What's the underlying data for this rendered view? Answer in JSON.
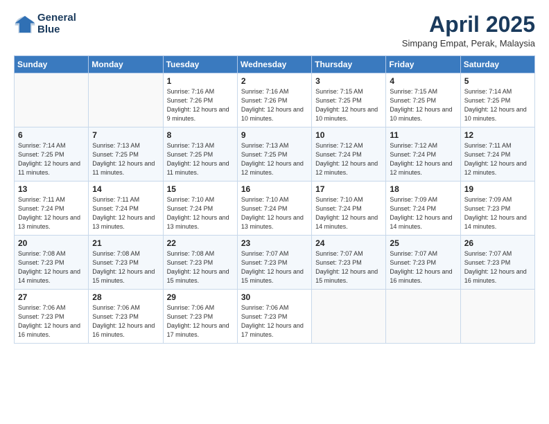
{
  "header": {
    "logo_line1": "General",
    "logo_line2": "Blue",
    "title": "April 2025",
    "subtitle": "Simpang Empat, Perak, Malaysia"
  },
  "days_of_week": [
    "Sunday",
    "Monday",
    "Tuesday",
    "Wednesday",
    "Thursday",
    "Friday",
    "Saturday"
  ],
  "weeks": [
    [
      {
        "day": "",
        "sunrise": "",
        "sunset": "",
        "daylight": ""
      },
      {
        "day": "",
        "sunrise": "",
        "sunset": "",
        "daylight": ""
      },
      {
        "day": "1",
        "sunrise": "Sunrise: 7:16 AM",
        "sunset": "Sunset: 7:26 PM",
        "daylight": "Daylight: 12 hours and 9 minutes."
      },
      {
        "day": "2",
        "sunrise": "Sunrise: 7:16 AM",
        "sunset": "Sunset: 7:26 PM",
        "daylight": "Daylight: 12 hours and 10 minutes."
      },
      {
        "day": "3",
        "sunrise": "Sunrise: 7:15 AM",
        "sunset": "Sunset: 7:25 PM",
        "daylight": "Daylight: 12 hours and 10 minutes."
      },
      {
        "day": "4",
        "sunrise": "Sunrise: 7:15 AM",
        "sunset": "Sunset: 7:25 PM",
        "daylight": "Daylight: 12 hours and 10 minutes."
      },
      {
        "day": "5",
        "sunrise": "Sunrise: 7:14 AM",
        "sunset": "Sunset: 7:25 PM",
        "daylight": "Daylight: 12 hours and 10 minutes."
      }
    ],
    [
      {
        "day": "6",
        "sunrise": "Sunrise: 7:14 AM",
        "sunset": "Sunset: 7:25 PM",
        "daylight": "Daylight: 12 hours and 11 minutes."
      },
      {
        "day": "7",
        "sunrise": "Sunrise: 7:13 AM",
        "sunset": "Sunset: 7:25 PM",
        "daylight": "Daylight: 12 hours and 11 minutes."
      },
      {
        "day": "8",
        "sunrise": "Sunrise: 7:13 AM",
        "sunset": "Sunset: 7:25 PM",
        "daylight": "Daylight: 12 hours and 11 minutes."
      },
      {
        "day": "9",
        "sunrise": "Sunrise: 7:13 AM",
        "sunset": "Sunset: 7:25 PM",
        "daylight": "Daylight: 12 hours and 12 minutes."
      },
      {
        "day": "10",
        "sunrise": "Sunrise: 7:12 AM",
        "sunset": "Sunset: 7:24 PM",
        "daylight": "Daylight: 12 hours and 12 minutes."
      },
      {
        "day": "11",
        "sunrise": "Sunrise: 7:12 AM",
        "sunset": "Sunset: 7:24 PM",
        "daylight": "Daylight: 12 hours and 12 minutes."
      },
      {
        "day": "12",
        "sunrise": "Sunrise: 7:11 AM",
        "sunset": "Sunset: 7:24 PM",
        "daylight": "Daylight: 12 hours and 12 minutes."
      }
    ],
    [
      {
        "day": "13",
        "sunrise": "Sunrise: 7:11 AM",
        "sunset": "Sunset: 7:24 PM",
        "daylight": "Daylight: 12 hours and 13 minutes."
      },
      {
        "day": "14",
        "sunrise": "Sunrise: 7:11 AM",
        "sunset": "Sunset: 7:24 PM",
        "daylight": "Daylight: 12 hours and 13 minutes."
      },
      {
        "day": "15",
        "sunrise": "Sunrise: 7:10 AM",
        "sunset": "Sunset: 7:24 PM",
        "daylight": "Daylight: 12 hours and 13 minutes."
      },
      {
        "day": "16",
        "sunrise": "Sunrise: 7:10 AM",
        "sunset": "Sunset: 7:24 PM",
        "daylight": "Daylight: 12 hours and 13 minutes."
      },
      {
        "day": "17",
        "sunrise": "Sunrise: 7:10 AM",
        "sunset": "Sunset: 7:24 PM",
        "daylight": "Daylight: 12 hours and 14 minutes."
      },
      {
        "day": "18",
        "sunrise": "Sunrise: 7:09 AM",
        "sunset": "Sunset: 7:24 PM",
        "daylight": "Daylight: 12 hours and 14 minutes."
      },
      {
        "day": "19",
        "sunrise": "Sunrise: 7:09 AM",
        "sunset": "Sunset: 7:23 PM",
        "daylight": "Daylight: 12 hours and 14 minutes."
      }
    ],
    [
      {
        "day": "20",
        "sunrise": "Sunrise: 7:08 AM",
        "sunset": "Sunset: 7:23 PM",
        "daylight": "Daylight: 12 hours and 14 minutes."
      },
      {
        "day": "21",
        "sunrise": "Sunrise: 7:08 AM",
        "sunset": "Sunset: 7:23 PM",
        "daylight": "Daylight: 12 hours and 15 minutes."
      },
      {
        "day": "22",
        "sunrise": "Sunrise: 7:08 AM",
        "sunset": "Sunset: 7:23 PM",
        "daylight": "Daylight: 12 hours and 15 minutes."
      },
      {
        "day": "23",
        "sunrise": "Sunrise: 7:07 AM",
        "sunset": "Sunset: 7:23 PM",
        "daylight": "Daylight: 12 hours and 15 minutes."
      },
      {
        "day": "24",
        "sunrise": "Sunrise: 7:07 AM",
        "sunset": "Sunset: 7:23 PM",
        "daylight": "Daylight: 12 hours and 15 minutes."
      },
      {
        "day": "25",
        "sunrise": "Sunrise: 7:07 AM",
        "sunset": "Sunset: 7:23 PM",
        "daylight": "Daylight: 12 hours and 16 minutes."
      },
      {
        "day": "26",
        "sunrise": "Sunrise: 7:07 AM",
        "sunset": "Sunset: 7:23 PM",
        "daylight": "Daylight: 12 hours and 16 minutes."
      }
    ],
    [
      {
        "day": "27",
        "sunrise": "Sunrise: 7:06 AM",
        "sunset": "Sunset: 7:23 PM",
        "daylight": "Daylight: 12 hours and 16 minutes."
      },
      {
        "day": "28",
        "sunrise": "Sunrise: 7:06 AM",
        "sunset": "Sunset: 7:23 PM",
        "daylight": "Daylight: 12 hours and 16 minutes."
      },
      {
        "day": "29",
        "sunrise": "Sunrise: 7:06 AM",
        "sunset": "Sunset: 7:23 PM",
        "daylight": "Daylight: 12 hours and 17 minutes."
      },
      {
        "day": "30",
        "sunrise": "Sunrise: 7:06 AM",
        "sunset": "Sunset: 7:23 PM",
        "daylight": "Daylight: 12 hours and 17 minutes."
      },
      {
        "day": "",
        "sunrise": "",
        "sunset": "",
        "daylight": ""
      },
      {
        "day": "",
        "sunrise": "",
        "sunset": "",
        "daylight": ""
      },
      {
        "day": "",
        "sunrise": "",
        "sunset": "",
        "daylight": ""
      }
    ]
  ]
}
